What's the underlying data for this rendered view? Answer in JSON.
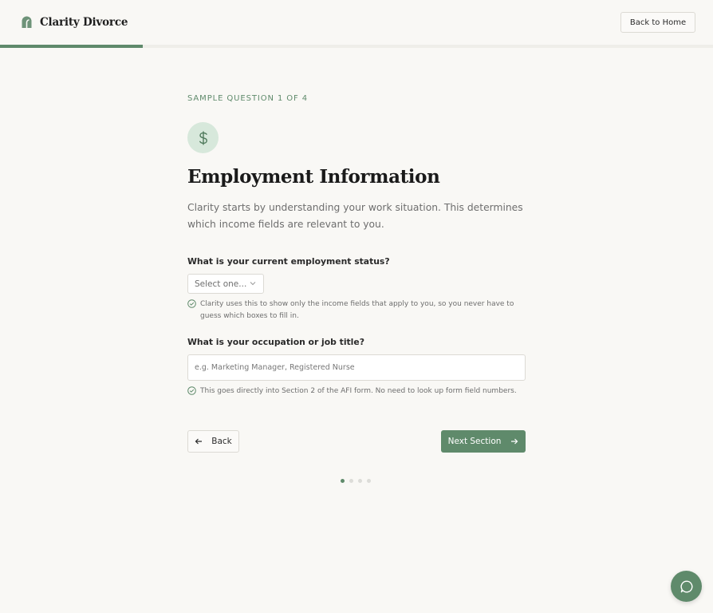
{
  "header": {
    "brand_name": "Clarity Divorce",
    "back_home_label": "Back to Home"
  },
  "progress": {
    "fraction": 0.2
  },
  "question": {
    "eyebrow": "SAMPLE QUESTION 1 OF 4",
    "icon": "dollar-icon",
    "title": "Employment Information",
    "lead": "Clarity starts by understanding your work situation. This determines which income fields are relevant to you."
  },
  "fields": {
    "employment_status": {
      "label": "What is your current employment status?",
      "selected": "Select one...",
      "hint": "Clarity uses this to show only the income fields that apply to you, so you never have to guess which boxes to fill in."
    },
    "occupation": {
      "label": "What is your occupation or job title?",
      "value": "",
      "placeholder": "e.g. Marketing Manager, Registered Nurse",
      "hint": "This goes directly into Section 2 of the AFI form. No need to look up form field numbers."
    }
  },
  "nav": {
    "back_label": "Back",
    "next_label": "Next Section"
  },
  "pagination": {
    "total": 4,
    "current": 1
  },
  "colors": {
    "accent": "#5f8a6b",
    "accent_light": "#d7e8db",
    "background": "#f9f8f5"
  },
  "chat": {
    "icon": "chat-bubble-icon"
  }
}
